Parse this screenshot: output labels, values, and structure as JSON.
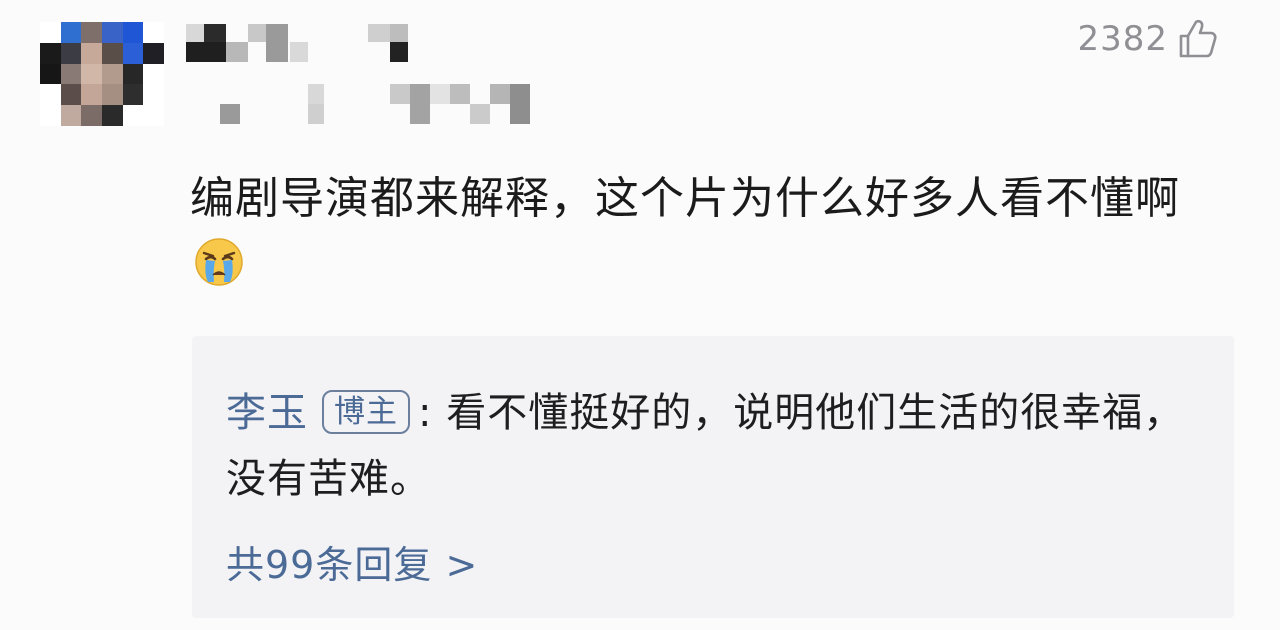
{
  "comment": {
    "like_count": "2382",
    "like_icon": "thumbs-up-icon",
    "text": "编剧导演都来解释，这个片为什么好多人看不懂啊",
    "emoji": "crying-face-emoji"
  },
  "reply": {
    "author": "李玉",
    "badge": "博主",
    "separator": ":",
    "text": "看不懂挺好的，说明他们生活的很幸福，没有苦难。"
  },
  "more_replies": {
    "label": "共99条回复",
    "chevron": ">"
  },
  "colors": {
    "link": "#4b6a96",
    "text": "#1b1b1c",
    "muted": "#8f8f94",
    "reply_bg": "#f3f3f6"
  }
}
